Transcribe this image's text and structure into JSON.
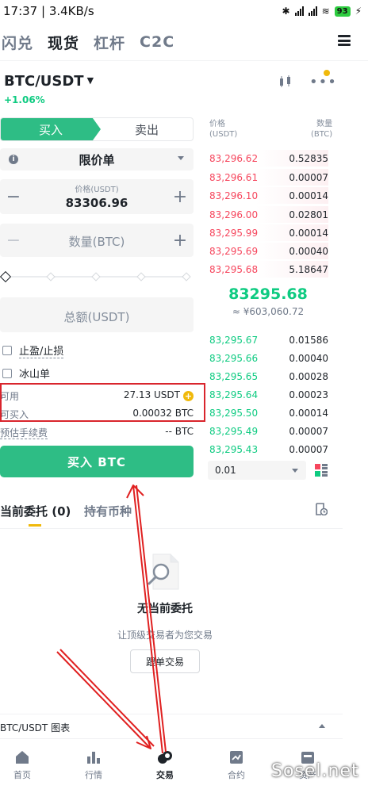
{
  "status": {
    "time_speed": "17:37 | 3.4KB/s",
    "battery": "93"
  },
  "topnav": {
    "tabs": [
      "闪兑",
      "现货",
      "杠杆",
      "C2C"
    ]
  },
  "pair": {
    "symbol": "BTC/USDT",
    "change": "+1.06%"
  },
  "form": {
    "buy_label": "买入",
    "sell_label": "卖出",
    "order_type": "限价单",
    "price_label": "价格(USDT)",
    "price_value": "83306.96",
    "quantity_placeholder": "数量(BTC)",
    "total_placeholder": "总额(USDT)",
    "tpsl_label": "止盈/止损",
    "iceberg_label": "冰山单",
    "available_label": "可用",
    "available_value": "27.13 USDT",
    "can_buy_label": "可买入",
    "can_buy_value": "0.00032 BTC",
    "fee_label": "预估手续费",
    "fee_value": "-- BTC",
    "submit_label": "买入 BTC"
  },
  "orderbook": {
    "price_header": "价格",
    "price_unit": "(USDT)",
    "amount_header": "数量",
    "amount_unit": "(BTC)",
    "asks": [
      {
        "price": "83,296.62",
        "amount": "0.52835"
      },
      {
        "price": "83,296.61",
        "amount": "0.00007"
      },
      {
        "price": "83,296.10",
        "amount": "0.00014"
      },
      {
        "price": "83,296.00",
        "amount": "0.02801"
      },
      {
        "price": "83,295.99",
        "amount": "0.00014"
      },
      {
        "price": "83,295.69",
        "amount": "0.00040"
      },
      {
        "price": "83,295.68",
        "amount": "5.18647"
      }
    ],
    "last_price": "83295.68",
    "last_price_cny": "≈ ¥603,060.72",
    "bids": [
      {
        "price": "83,295.67",
        "amount": "0.01586"
      },
      {
        "price": "83,295.66",
        "amount": "0.00040"
      },
      {
        "price": "83,295.65",
        "amount": "0.00028"
      },
      {
        "price": "83,295.64",
        "amount": "0.00023"
      },
      {
        "price": "83,295.50",
        "amount": "0.00014"
      },
      {
        "price": "83,295.49",
        "amount": "0.00007"
      },
      {
        "price": "83,295.43",
        "amount": "0.00007"
      }
    ],
    "depth": "0.01"
  },
  "orders": {
    "tab_open": "当前委托 (0)",
    "tab_holdings": "持有币种",
    "empty_title": "无当前委托",
    "empty_sub": "让顶级交易者为您交易",
    "copy_button": "跟单交易"
  },
  "chart_bar": {
    "label": "BTC/USDT 图表"
  },
  "bottomnav": {
    "items": [
      "首页",
      "行情",
      "交易",
      "合约",
      "资产"
    ]
  },
  "watermark": "Sosel.net",
  "colors": {
    "buy_green": "#2ebd85",
    "price_up": "#0ecb81",
    "price_down": "#f6465d",
    "accent_yellow": "#f0b90b",
    "annotation_red": "#d9252d"
  }
}
